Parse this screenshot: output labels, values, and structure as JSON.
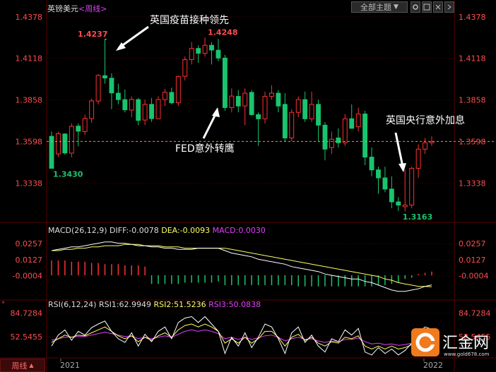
{
  "header": {
    "symbol": "英镑美元",
    "period": "<周线>",
    "theme_select": "全部主题",
    "theme_arrow": "▼"
  },
  "watermark": {
    "brand": "汇金网",
    "url": "www.gold678.com"
  },
  "bottom_bar": {
    "period_label": "周线",
    "period_arrow": "▲"
  },
  "annotations": {
    "vaccine": "英国疫苗接种领先",
    "fed": "FED意外转鹰",
    "boe": "英国央行意外加息"
  },
  "colors": {
    "up": "#ff3030",
    "down": "#19c46e",
    "bg": "#000000",
    "grid": "#5a0000",
    "price_axis": "#ff4d4d",
    "diff": "#ffffff",
    "dea": "#ffff66",
    "macd": "#e040fb",
    "rsi1": "#ffffff",
    "rsi2": "#ffff66",
    "rsi3": "#e040fb",
    "last_price_line": "#ff8c3c"
  },
  "chart_data": [
    {
      "type": "candlestick",
      "series_name": "英镑美元 周线",
      "y_ticks": [
        1.4378,
        1.4118,
        1.3858,
        1.3598,
        1.3338
      ],
      "ylim": [
        1.3105,
        1.4395
      ],
      "x_tick_labels": [
        "2021",
        "2022"
      ],
      "last_price": 1.3598,
      "price_labels": {
        "high_1": 1.4237,
        "high_2": 1.4248,
        "low_1": 1.343,
        "low_2": 1.3163
      },
      "candles": [
        [
          1.363,
          1.366,
          1.349,
          1.343
        ],
        [
          1.352,
          1.3658,
          1.35,
          1.3646
        ],
        [
          1.3645,
          1.3649,
          1.3515,
          1.3526
        ],
        [
          1.3525,
          1.3712,
          1.3499,
          1.3693
        ],
        [
          1.3694,
          1.3711,
          1.3568,
          1.3662
        ],
        [
          1.366,
          1.3766,
          1.364,
          1.3742
        ],
        [
          1.3741,
          1.3866,
          1.3715,
          1.3852
        ],
        [
          1.3851,
          1.402,
          1.383,
          1.4011
        ],
        [
          1.401,
          1.4237,
          1.396,
          1.3995
        ],
        [
          1.3994,
          1.4025,
          1.38,
          1.3902
        ],
        [
          1.39,
          1.396,
          1.383,
          1.386
        ],
        [
          1.386,
          1.3923,
          1.378,
          1.3796
        ],
        [
          1.3794,
          1.388,
          1.375,
          1.3861
        ],
        [
          1.386,
          1.387,
          1.37,
          1.373
        ],
        [
          1.3732,
          1.386,
          1.3701,
          1.383
        ],
        [
          1.383,
          1.387,
          1.372,
          1.3741
        ],
        [
          1.374,
          1.388,
          1.374,
          1.386
        ],
        [
          1.386,
          1.3927,
          1.382,
          1.3906
        ],
        [
          1.3905,
          1.3935,
          1.383,
          1.384
        ],
        [
          1.384,
          1.401,
          1.382,
          1.4005
        ],
        [
          1.4006,
          1.413,
          1.398,
          1.411
        ],
        [
          1.411,
          1.422,
          1.408,
          1.418
        ],
        [
          1.418,
          1.42,
          1.409,
          1.415
        ],
        [
          1.415,
          1.4248,
          1.413,
          1.42
        ],
        [
          1.42,
          1.422,
          1.408,
          1.417
        ],
        [
          1.4169,
          1.424,
          1.41,
          1.412
        ],
        [
          1.412,
          1.414,
          1.379,
          1.381
        ],
        [
          1.381,
          1.393,
          1.378,
          1.3882
        ],
        [
          1.388,
          1.392,
          1.378,
          1.382
        ],
        [
          1.382,
          1.393,
          1.37,
          1.39
        ],
        [
          1.3905,
          1.392,
          1.376,
          1.3766
        ],
        [
          1.3766,
          1.378,
          1.357,
          1.374
        ],
        [
          1.374,
          1.391,
          1.371,
          1.388
        ],
        [
          1.388,
          1.395,
          1.386,
          1.39
        ],
        [
          1.39,
          1.392,
          1.378,
          1.382
        ],
        [
          1.383,
          1.39,
          1.36,
          1.362
        ],
        [
          1.362,
          1.38,
          1.36,
          1.378
        ],
        [
          1.378,
          1.388,
          1.375,
          1.386
        ],
        [
          1.386,
          1.391,
          1.372,
          1.374
        ],
        [
          1.374,
          1.391,
          1.372,
          1.383
        ],
        [
          1.383,
          1.386,
          1.36,
          1.37
        ],
        [
          1.37,
          1.372,
          1.348,
          1.355
        ],
        [
          1.356,
          1.366,
          1.352,
          1.3612
        ],
        [
          1.362,
          1.368,
          1.356,
          1.359
        ],
        [
          1.359,
          1.377,
          1.357,
          1.374
        ],
        [
          1.374,
          1.383,
          1.369,
          1.368
        ],
        [
          1.369,
          1.381,
          1.366,
          1.377
        ],
        [
          1.377,
          1.379,
          1.345,
          1.35
        ],
        [
          1.35,
          1.356,
          1.338,
          1.342
        ],
        [
          1.342,
          1.344,
          1.327,
          1.337
        ],
        [
          1.337,
          1.344,
          1.328,
          1.33
        ],
        [
          1.33,
          1.338,
          1.318,
          1.322
        ],
        [
          1.322,
          1.325,
          1.3163,
          1.32
        ],
        [
          1.319,
          1.342,
          1.316,
          1.32
        ],
        [
          1.32,
          1.344,
          1.318,
          1.343
        ],
        [
          1.343,
          1.358,
          1.337,
          1.355
        ],
        [
          1.355,
          1.362,
          1.352,
          1.359
        ],
        [
          1.359,
          1.363,
          1.357,
          1.3598
        ]
      ]
    },
    {
      "type": "macd",
      "title": "MACD(26,12,9)",
      "diff": -0.0078,
      "dea": -0.0093,
      "macd": 0.003,
      "y_ticks": [
        0.0257,
        0.0127,
        -0.0004
      ],
      "ylim": [
        -0.0172,
        0.0332
      ],
      "diff_series": [
        0.02,
        0.021,
        0.022,
        0.023,
        0.023,
        0.024,
        0.025,
        0.026,
        0.027,
        0.027,
        0.026,
        0.026,
        0.025,
        0.024,
        0.024,
        0.023,
        0.023,
        0.022,
        0.022,
        0.021,
        0.021,
        0.021,
        0.022,
        0.022,
        0.022,
        0.022,
        0.02,
        0.018,
        0.017,
        0.016,
        0.015,
        0.013,
        0.012,
        0.011,
        0.01,
        0.009,
        0.007,
        0.006,
        0.005,
        0.004,
        0.003,
        0.001,
        0.0,
        -0.001,
        -0.002,
        -0.003,
        -0.003,
        -0.005,
        -0.006,
        -0.008,
        -0.01,
        -0.012,
        -0.013,
        -0.013,
        -0.012,
        -0.011,
        -0.009,
        -0.0078
      ],
      "dea_series": [
        0.02,
        0.02,
        0.021,
        0.021,
        0.022,
        0.022,
        0.023,
        0.023,
        0.024,
        0.024,
        0.024,
        0.025,
        0.025,
        0.025,
        0.024,
        0.024,
        0.024,
        0.023,
        0.023,
        0.023,
        0.022,
        0.022,
        0.022,
        0.022,
        0.022,
        0.022,
        0.022,
        0.021,
        0.02,
        0.019,
        0.018,
        0.017,
        0.016,
        0.015,
        0.014,
        0.013,
        0.012,
        0.011,
        0.01,
        0.009,
        0.008,
        0.007,
        0.006,
        0.005,
        0.004,
        0.003,
        0.002,
        0.001,
        0.0,
        -0.001,
        -0.003,
        -0.004,
        -0.006,
        -0.007,
        -0.008,
        -0.009,
        -0.009,
        -0.0093
      ],
      "hist_series": [
        0.012,
        0.012,
        0.012,
        0.011,
        0.011,
        0.011,
        0.01,
        0.01,
        0.009,
        0.009,
        0.009,
        0.008,
        0.008,
        0.008,
        0.007,
        -0.007,
        -0.007,
        -0.007,
        -0.007,
        -0.007,
        -0.006,
        -0.006,
        -0.006,
        -0.006,
        -0.006,
        -0.005,
        -0.008,
        -0.008,
        -0.008,
        -0.008,
        -0.008,
        -0.008,
        -0.008,
        -0.008,
        -0.008,
        -0.008,
        -0.008,
        -0.009,
        -0.009,
        -0.009,
        -0.009,
        -0.009,
        -0.009,
        -0.009,
        -0.009,
        -0.009,
        -0.009,
        -0.009,
        -0.009,
        -0.008,
        -0.008,
        -0.007,
        -0.006,
        -0.003,
        -0.002,
        0.001,
        0.002,
        0.003
      ]
    },
    {
      "type": "rsi",
      "title": "RSI(6,12,24)",
      "rsi1": 62.9949,
      "rsi2": 51.5236,
      "rsi3": 50.0838,
      "y_ticks": [
        84.7284,
        52.5455
      ],
      "ylim": [
        25,
        92
      ],
      "rsi1_series": [
        40,
        55,
        62,
        48,
        60,
        55,
        65,
        70,
        74,
        60,
        50,
        45,
        58,
        40,
        56,
        46,
        60,
        66,
        50,
        72,
        78,
        80,
        72,
        80,
        70,
        60,
        30,
        52,
        40,
        58,
        38,
        52,
        70,
        66,
        50,
        30,
        58,
        66,
        45,
        55,
        40,
        32,
        50,
        46,
        62,
        55,
        64,
        32,
        28,
        38,
        30,
        36,
        28,
        34,
        44,
        58,
        66,
        62.9949
      ],
      "rsi2_series": [
        45,
        50,
        55,
        52,
        55,
        54,
        58,
        62,
        66,
        60,
        54,
        50,
        54,
        46,
        52,
        48,
        54,
        58,
        52,
        62,
        68,
        70,
        66,
        70,
        66,
        60,
        44,
        50,
        44,
        52,
        44,
        50,
        60,
        60,
        52,
        40,
        52,
        56,
        48,
        52,
        44,
        40,
        46,
        44,
        52,
        50,
        54,
        40,
        36,
        40,
        36,
        40,
        36,
        38,
        42,
        48,
        52,
        51.5236
      ],
      "rsi3_series": [
        48,
        50,
        52,
        52,
        53,
        53,
        55,
        57,
        59,
        57,
        55,
        53,
        54,
        50,
        52,
        50,
        52,
        54,
        52,
        56,
        60,
        62,
        60,
        62,
        60,
        57,
        50,
        52,
        49,
        52,
        49,
        51,
        54,
        55,
        52,
        47,
        50,
        52,
        49,
        50,
        47,
        45,
        47,
        46,
        49,
        49,
        51,
        46,
        43,
        44,
        42,
        43,
        41,
        42,
        44,
        47,
        50,
        50.0838
      ]
    }
  ]
}
